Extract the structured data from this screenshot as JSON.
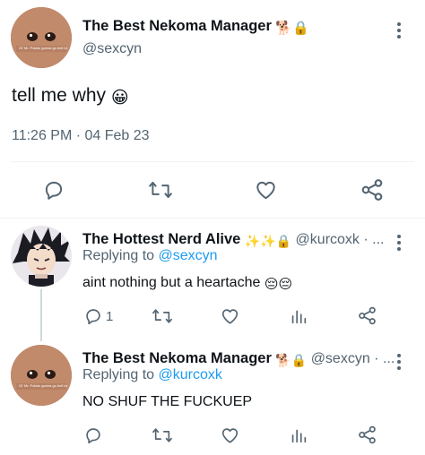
{
  "main_tweet": {
    "author_name": "The Best Nekoma Manager",
    "author_emoji": "🐕🔒",
    "handle": "@sexcyn",
    "avatar_caption": "Ol' Mr. Potato gonna go bell bell",
    "text": "tell me why",
    "text_emoji": "😀",
    "time": "11:26 PM · 04 Feb 23",
    "actions": [
      "reply-icon",
      "retweet-icon",
      "like-icon",
      "share-icon"
    ]
  },
  "replies": [
    {
      "author_name": "The Hottest Nerd Alive",
      "author_emoji": "✨✨🔒",
      "handle": "@kurcoxk · ...",
      "replying_prefix": "Replying to",
      "replying_to": "@sexcyn",
      "text": "aint nothing but a heartache",
      "text_emoji": "😔😔",
      "reply_count": "1",
      "actions": [
        "reply-icon",
        "retweet-icon",
        "like-icon",
        "analytics-icon",
        "share-icon"
      ]
    },
    {
      "author_name": "The Best Nekoma Manager",
      "author_emoji": "🐕🔒",
      "handle": "@sexcyn · ...",
      "avatar_caption": "Ol' Mr. Potato gonna go bell bell",
      "replying_prefix": "Replying to",
      "replying_to": "@kurcoxk",
      "text": "NO SHUF THE FUCKUEP",
      "reply_count": "",
      "actions": [
        "reply-icon",
        "retweet-icon",
        "like-icon",
        "analytics-icon",
        "share-icon"
      ]
    }
  ],
  "colors": {
    "accent": "#1d9bf0",
    "secondary_text": "#536471",
    "divider": "#eff3f4"
  }
}
